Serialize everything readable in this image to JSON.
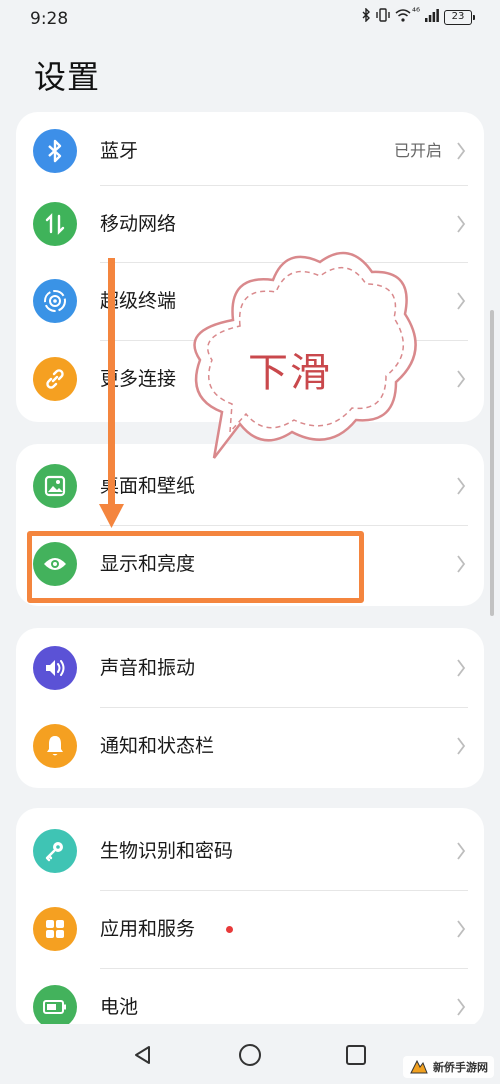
{
  "status_bar": {
    "time": "9:28",
    "network": "⁴⁶",
    "battery": "23"
  },
  "page_title": "设置",
  "groups": [
    {
      "items": [
        {
          "label": "蓝牙",
          "icon": "bluetooth-icon",
          "color": "#3d8fe8",
          "value": "已开启"
        },
        {
          "label": "移动网络",
          "icon": "mobile-data-icon",
          "color": "#3fb35a"
        },
        {
          "label": "超级终端",
          "icon": "super-device-icon",
          "color": "#3a93e6"
        },
        {
          "label": "更多连接",
          "icon": "link-icon",
          "color": "#f5a021"
        }
      ]
    },
    {
      "items": [
        {
          "label": "桌面和壁纸",
          "icon": "wallpaper-icon",
          "color": "#43b25c"
        },
        {
          "label": "显示和亮度",
          "icon": "eye-icon",
          "color": "#43b25c"
        }
      ]
    },
    {
      "items": [
        {
          "label": "声音和振动",
          "icon": "speaker-icon",
          "color": "#5b52d6"
        },
        {
          "label": "通知和状态栏",
          "icon": "bell-icon",
          "color": "#f5a021"
        }
      ]
    },
    {
      "items": [
        {
          "label": "生物识别和密码",
          "icon": "key-icon",
          "color": "#3fc4b4"
        },
        {
          "label": "应用和服务",
          "icon": "apps-icon",
          "color": "#f5a021",
          "badge": true
        },
        {
          "label": "电池",
          "icon": "battery-icon",
          "color": "#43b25c"
        }
      ]
    }
  ],
  "annotation": {
    "bubble_text": "下滑",
    "arrow_color": "#f4853e",
    "bubble_color": "#d9898c"
  },
  "watermark": {
    "text": "新侨手游网"
  }
}
